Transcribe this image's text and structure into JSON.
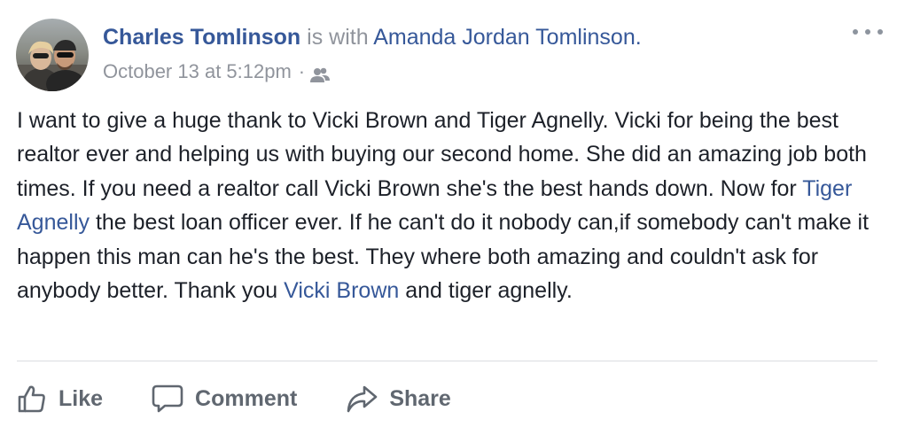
{
  "post": {
    "author": "Charles Tomlinson",
    "with_text": "is with",
    "tagged_person": "Amanda Jordan Tomlinson",
    "tagged_suffix": ".",
    "timestamp": "October 13 at 5:12pm",
    "meta_separator": "·",
    "audience_icon": "friends-icon",
    "more_icon": "more-options-icon",
    "body": {
      "p1": "I want to give a huge thank to Vicki Brown and Tiger Agnelly. Vicki for being the best realtor ever and helping us with buying our second home. She did an amazing job both times. If you need a realtor call Vicki Brown she's the best hands down. Now for ",
      "mention1": "Tiger Agnelly",
      "p2": " the best loan officer ever. If he can't do it nobody can,if somebody can't make it happen this man can he's the best. They where both amazing and couldn't ask for anybody better. Thank you ",
      "mention2": "Vicki Brown",
      "p3": " and tiger agnelly."
    }
  },
  "actions": {
    "like_label": "Like",
    "like_icon": "thumbs-up-icon",
    "comment_label": "Comment",
    "comment_icon": "speech-bubble-icon",
    "share_label": "Share",
    "share_icon": "share-arrow-icon"
  },
  "colors": {
    "link": "#365899",
    "meta": "#90949c",
    "body_text": "#1d2129",
    "action_text": "#606770",
    "divider": "#dadde1"
  }
}
